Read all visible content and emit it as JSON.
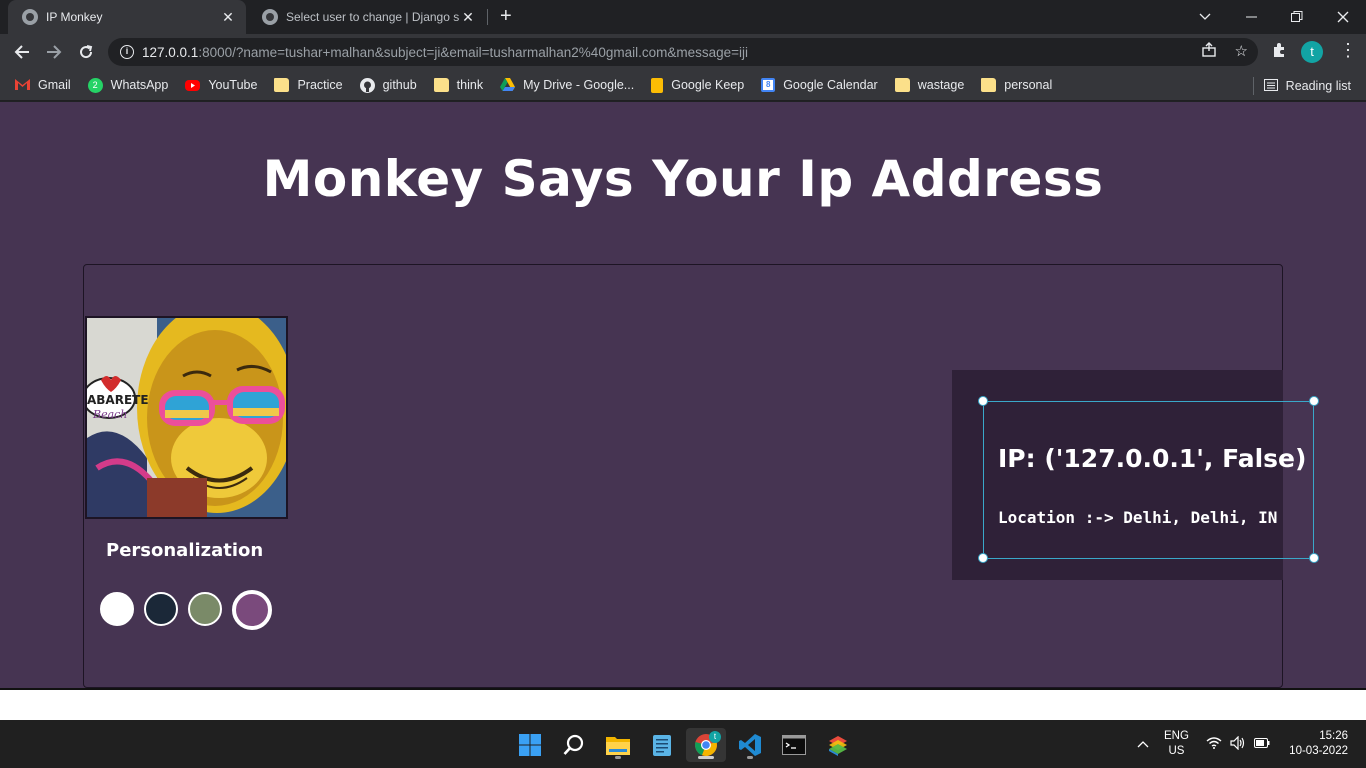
{
  "browser": {
    "tabs": [
      {
        "title": "IP Monkey",
        "active": true
      },
      {
        "title": "Select user to change | Django si",
        "active": false
      }
    ],
    "url_host": "127.0.0.1",
    "url_rest": ":8000/?name=tushar+malhan&subject=ji&email=tusharmalhan2%40gmail.com&message=iji",
    "profile_initial": "t",
    "bookmarks": [
      {
        "label": "Gmail",
        "icon": "gmail-icon",
        "color": "#ea4335"
      },
      {
        "label": "WhatsApp",
        "icon": "whatsapp-icon",
        "color": "#25d366",
        "badge": "2"
      },
      {
        "label": "YouTube",
        "icon": "youtube-icon",
        "color": "#ff0000"
      },
      {
        "label": "Practice",
        "icon": "folder-icon"
      },
      {
        "label": "github",
        "icon": "github-icon"
      },
      {
        "label": "think",
        "icon": "folder-icon"
      },
      {
        "label": "My Drive - Google...",
        "icon": "google-drive-icon"
      },
      {
        "label": "Google Keep",
        "icon": "google-keep-icon",
        "color": "#fbbc04"
      },
      {
        "label": "Google Calendar",
        "icon": "google-calendar-icon",
        "color": "#4285f4",
        "badge": "8"
      },
      {
        "label": "wastage",
        "icon": "folder-icon"
      },
      {
        "label": "personal",
        "icon": "folder-icon"
      }
    ],
    "reading_list_label": "Reading list"
  },
  "page": {
    "title": "Monkey Says Your Ip Address",
    "personalization_label": "Personalization",
    "swatches": [
      {
        "name": "white",
        "color": "#ffffff"
      },
      {
        "name": "navy",
        "color": "#1b2838"
      },
      {
        "name": "sage",
        "color": "#7a8a68"
      },
      {
        "name": "plum",
        "color": "#7a4a7c",
        "selected": true
      }
    ],
    "ip_text": "IP: ('127.0.0.1', False)",
    "location_text": "Location :-> Delhi, Delhi, IN",
    "background_color": "#463452"
  },
  "taskbar": {
    "apps": [
      "start-icon",
      "search-icon",
      "file-explorer-icon",
      "notepad-icon",
      "chrome-icon",
      "vscode-icon",
      "terminal-icon",
      "bluestacks-icon"
    ],
    "chrome_badge": "t",
    "language": "ENG",
    "region": "US",
    "time": "15:26",
    "date": "10-03-2022"
  }
}
